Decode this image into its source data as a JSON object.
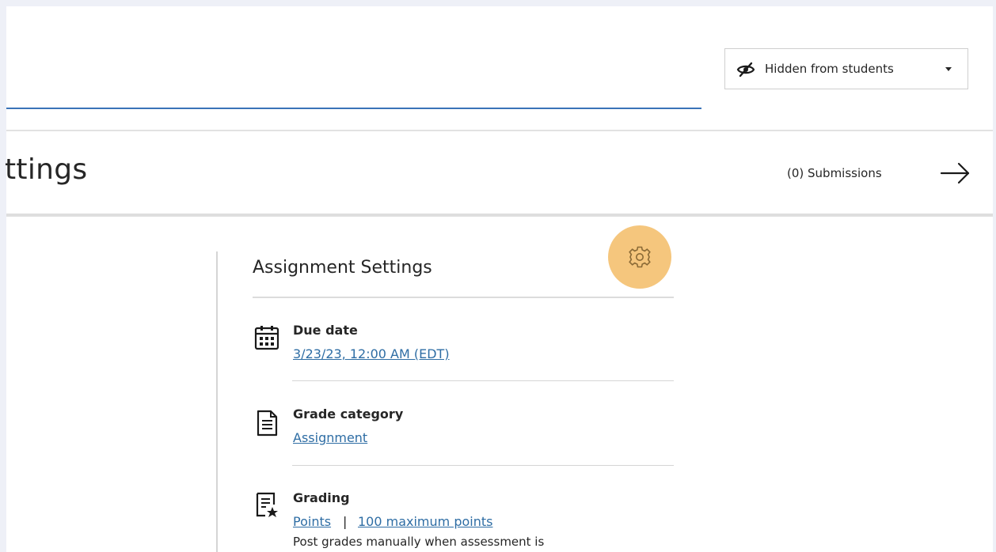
{
  "header": {
    "visibility_label": "Hidden from students",
    "page_title_partial": "ttings"
  },
  "submissions": {
    "label": "(0) Submissions"
  },
  "settings_panel": {
    "title": "Assignment Settings",
    "items": [
      {
        "icon": "calendar-icon",
        "label": "Due date",
        "link": "3/23/23, 12:00 AM (EDT)"
      },
      {
        "icon": "document-icon",
        "label": "Grade category",
        "link": "Assignment"
      },
      {
        "icon": "grading-icon",
        "label": "Grading",
        "link_points": "Points",
        "separator": "|",
        "link_max": "100 maximum points",
        "note": "Post grades manually when assessment is"
      }
    ]
  },
  "colors": {
    "link": "#2e6da4",
    "underline_accent": "#3a73b8",
    "gear_highlight": "#f5c67d",
    "text": "#262626"
  }
}
